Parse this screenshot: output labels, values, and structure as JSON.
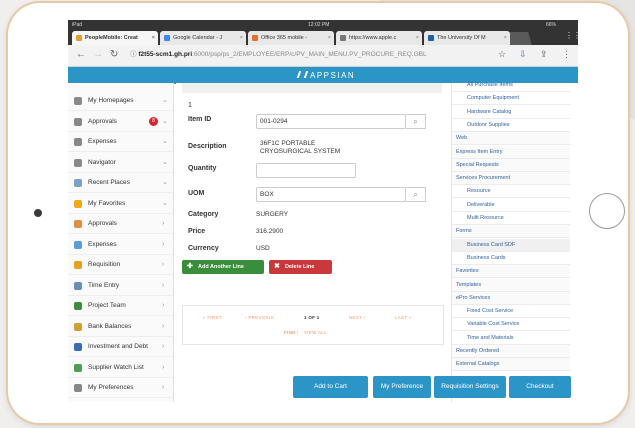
{
  "browser": {
    "status": {
      "left": "iPad",
      "time": "12:02 PM",
      "battery": "66%"
    },
    "tabs": [
      {
        "label": "PeopleMobile: Creat",
        "color": "#e0a030",
        "active": true
      },
      {
        "label": "Google Calendar - J",
        "color": "#4285f4",
        "active": false
      },
      {
        "label": "Office 365 mobile -",
        "color": "#e8702a",
        "active": false
      },
      {
        "label": "https://www.apple.c",
        "color": "#777777",
        "active": false
      },
      {
        "label": "The University Of M",
        "color": "#1f5fa8",
        "active": false
      }
    ],
    "url_host": "f2t55-scm1.gh.pri",
    "url_path": ":6000/psp/ps_2/EMPLOYEE/ERP/c/PV_MAIN_MENU.PV_PROCURE_REQ.GBL"
  },
  "app": {
    "logo_text": "APPSIAN"
  },
  "sidebar": {
    "items": [
      {
        "label": "My Homepages",
        "icon": "home-icon",
        "color": "#888888",
        "chev": "⌄"
      },
      {
        "label": "Approvals",
        "icon": "approval-icon",
        "color": "#888888",
        "chev": "⌄",
        "badge": "8"
      },
      {
        "label": "Expenses",
        "icon": "dollar-icon",
        "color": "#888888",
        "chev": "⌄"
      },
      {
        "label": "Navigator",
        "icon": "compass-icon",
        "color": "#888888",
        "chev": "⌄"
      },
      {
        "label": "Recent Places",
        "icon": "calendar-icon",
        "color": "#7aa3c9",
        "chev": "⌄"
      },
      {
        "label": "My Favorites",
        "icon": "star-icon",
        "color": "#f2a81d",
        "chev": "⌄"
      },
      {
        "label": "Approvals",
        "icon": "document-icon",
        "color": "#e09040",
        "chev": "›"
      },
      {
        "label": "Expenses",
        "icon": "list-icon",
        "color": "#5a9fd6",
        "chev": "›"
      },
      {
        "label": "Requisition",
        "icon": "cart-icon",
        "color": "#e8a020",
        "chev": "›"
      },
      {
        "label": "Time Entry",
        "icon": "clock-icon",
        "color": "#6a8fb5",
        "chev": "›"
      },
      {
        "label": "Project Team",
        "icon": "team-icon",
        "color": "#3c8d3c",
        "chev": "›"
      },
      {
        "label": "Bank Balances",
        "icon": "bank-icon",
        "color": "#d0a030",
        "chev": "›"
      },
      {
        "label": "Investment and Debt",
        "icon": "chart-icon",
        "color": "#3a6fb0",
        "chev": "›"
      },
      {
        "label": "Supplier Watch List",
        "icon": "people-icon",
        "color": "#4aa050",
        "chev": "›"
      },
      {
        "label": "My Preferences",
        "icon": "preferences-icon",
        "color": "#888888",
        "chev": "›"
      }
    ]
  },
  "form": {
    "line_number": "1",
    "item_id_label": "Item ID",
    "item_id_value": "001-0294",
    "description_label": "Description",
    "description_line1": "36F1C PORTABLE",
    "description_line2": "CRYOSURGICAL SYSTEM",
    "quantity_label": "Quantity",
    "quantity_value": "",
    "uom_label": "UOM",
    "uom_value": "BOX",
    "category_label": "Category",
    "category_value": "SURGERY",
    "price_label": "Price",
    "price_value": "316.2900",
    "currency_label": "Currency",
    "currency_value": "USD",
    "add_line_label": "Add Another Line",
    "delete_line_label": "Delete Line"
  },
  "pager": {
    "first": "« FIRST",
    "previous": "‹ PREVIOUS",
    "position": "1 OF 1",
    "next": "NEXT ›",
    "last": "LAST »",
    "find": "FIND",
    "view_all": "VIEW ALL"
  },
  "right_panel": {
    "items": [
      {
        "label": "All Purchase Items",
        "type": "sub"
      },
      {
        "label": "Computer Equipment",
        "type": "sub"
      },
      {
        "label": "Hardware Catalog",
        "type": "sub"
      },
      {
        "label": "Outdoor Supplies",
        "type": "sub"
      },
      {
        "label": "Web",
        "type": "head"
      },
      {
        "label": "Express Item Entry",
        "type": "head"
      },
      {
        "label": "Special Requests",
        "type": "head"
      },
      {
        "label": "Services Procurement",
        "type": "head"
      },
      {
        "label": "Resource",
        "type": "sub"
      },
      {
        "label": "Deliverable",
        "type": "sub"
      },
      {
        "label": "Multi Resource",
        "type": "sub"
      },
      {
        "label": "Forms",
        "type": "head"
      },
      {
        "label": "Business Card SDF",
        "type": "sub",
        "hl": true
      },
      {
        "label": "Business Cards",
        "type": "sub"
      },
      {
        "label": "Favorites",
        "type": "head"
      },
      {
        "label": "Templates",
        "type": "head"
      },
      {
        "label": "ePro Services",
        "type": "head"
      },
      {
        "label": "Fixed Cost Service",
        "type": "sub"
      },
      {
        "label": "Variable Cost Service",
        "type": "sub"
      },
      {
        "label": "Time and Materials",
        "type": "sub"
      },
      {
        "label": "Recently Ordered",
        "type": "head"
      },
      {
        "label": "External Catalogs",
        "type": "head"
      }
    ]
  },
  "actions": {
    "add_to_cart": "Add to Cart",
    "my_preference": "My Preference",
    "requisition_settings": "Requisition Settings",
    "checkout": "Checkout"
  }
}
